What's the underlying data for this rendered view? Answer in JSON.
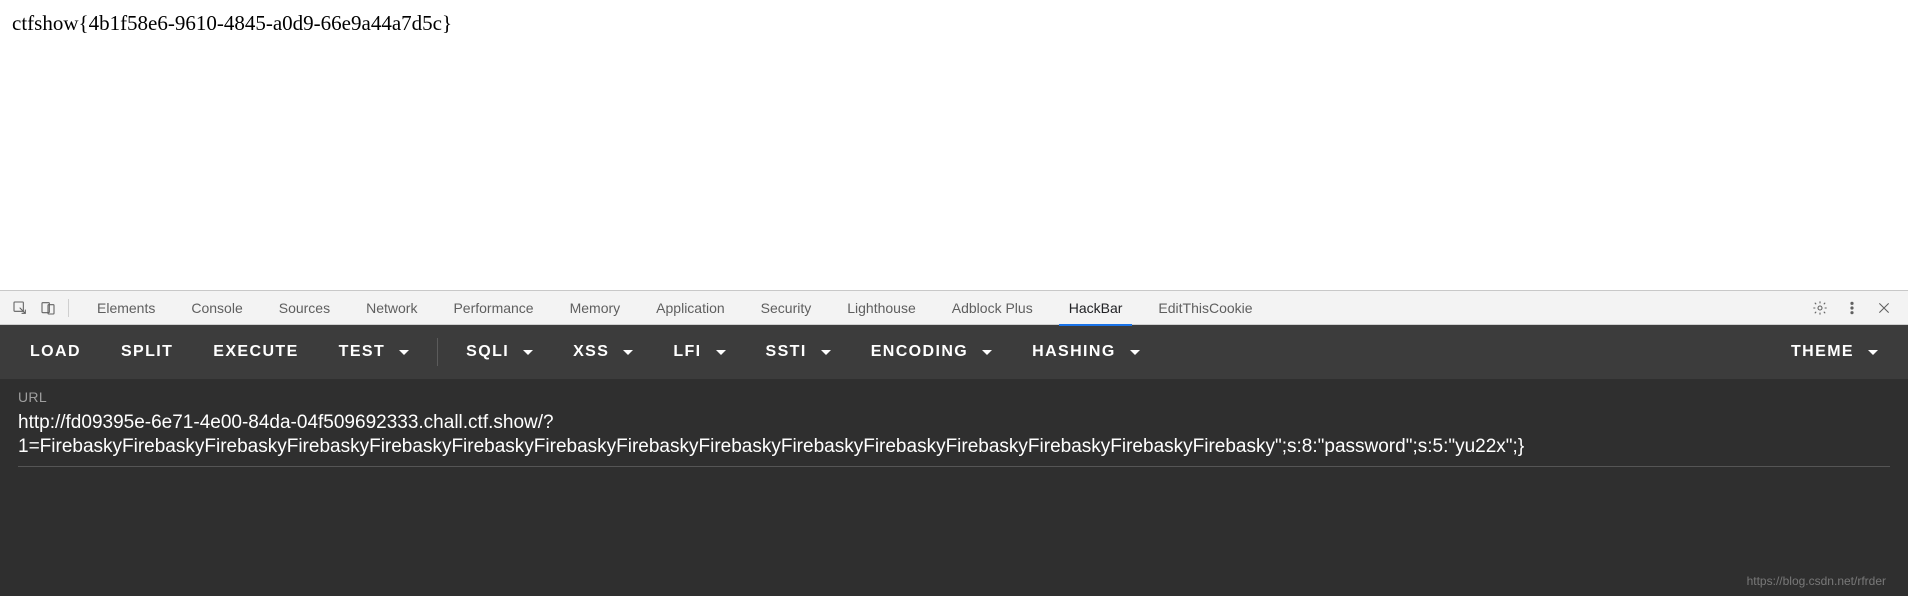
{
  "page": {
    "flag_text": "ctfshow{4b1f58e6-9610-4845-a0d9-66e9a44a7d5c}"
  },
  "devtools": {
    "tabs": [
      {
        "label": "Elements"
      },
      {
        "label": "Console"
      },
      {
        "label": "Sources"
      },
      {
        "label": "Network"
      },
      {
        "label": "Performance"
      },
      {
        "label": "Memory"
      },
      {
        "label": "Application"
      },
      {
        "label": "Security"
      },
      {
        "label": "Lighthouse"
      },
      {
        "label": "Adblock Plus"
      },
      {
        "label": "HackBar"
      },
      {
        "label": "EditThisCookie"
      }
    ],
    "active_tab_index": 10
  },
  "hackbar": {
    "toolbar": {
      "load": "LOAD",
      "split": "SPLIT",
      "execute": "EXECUTE",
      "test": "TEST",
      "sqli": "SQLI",
      "xss": "XSS",
      "lfi": "LFI",
      "ssti": "SSTI",
      "encoding": "ENCODING",
      "hashing": "HASHING",
      "theme": "THEME"
    },
    "url_label": "URL",
    "url_line1": "http://fd09395e-6e71-4e00-84da-04f509692333.chall.ctf.show/?",
    "url_line2": "1=FirebaskyFirebaskyFirebaskyFirebaskyFirebaskyFirebaskyFirebaskyFirebaskyFirebaskyFirebaskyFirebaskyFirebaskyFirebaskyFirebaskyFirebasky\";s:8:\"password\";s:5:\"yu22x\";}"
  },
  "watermark": "https://blog.csdn.net/rfrder"
}
